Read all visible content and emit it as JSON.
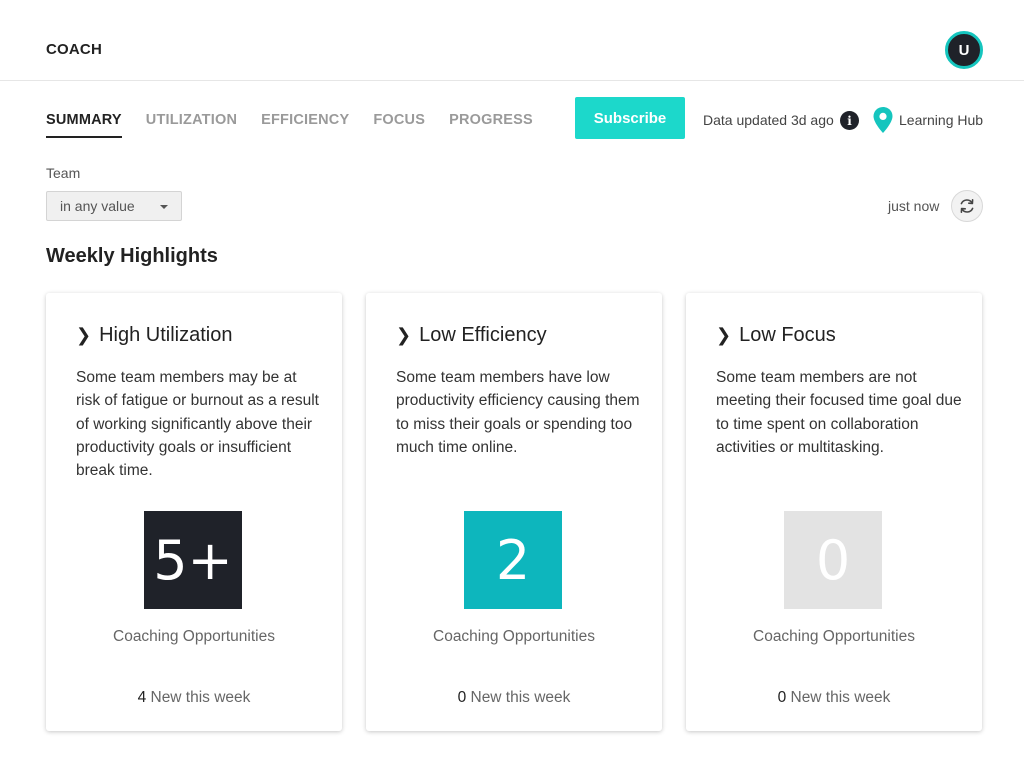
{
  "header": {
    "app_title": "COACH",
    "avatar_initial": "U"
  },
  "nav": {
    "tabs": [
      {
        "label": "SUMMARY",
        "active": true
      },
      {
        "label": "UTILIZATION",
        "active": false
      },
      {
        "label": "EFFICIENCY",
        "active": false
      },
      {
        "label": "FOCUS",
        "active": false
      },
      {
        "label": "PROGRESS",
        "active": false
      }
    ],
    "subscribe_label": "Subscribe",
    "data_updated": "Data updated 3d ago",
    "info_icon_glyph": "i",
    "learning_hub": "Learning Hub"
  },
  "filters": {
    "team_label": "Team",
    "team_value": "in any value",
    "last_refresh": "just now"
  },
  "section": {
    "title": "Weekly Highlights"
  },
  "cards": [
    {
      "title": "High Utilization",
      "description": "Some team members may be at risk of fatigue or burnout as a result of working significantly above their productivity goals or insufficient break time.",
      "count": "5+",
      "count_color": "#1f2229",
      "count_label": "Coaching Opportunities",
      "new_count": "4",
      "new_suffix": " New this week"
    },
    {
      "title": "Low Efficiency",
      "description": "Some team members have low productivity efficiency causing them to miss their goals or spending too much time online.",
      "count": "2",
      "count_color": "#0db6bd",
      "count_label": "Coaching Opportunities",
      "new_count": "0",
      "new_suffix": " New this week"
    },
    {
      "title": "Low Focus",
      "description": "Some team members are not meeting their focused time goal due to time spent on collaboration activities or multitasking.",
      "count": "0",
      "count_color": "#e3e3e3",
      "count_label": "Coaching Opportunities",
      "new_count": "0",
      "new_suffix": " New this week"
    }
  ],
  "colors": {
    "accent": "#1cd8cb",
    "avatar_ring": "#15c5be",
    "pin": "#15c5be",
    "dark": "#1f2229"
  },
  "icons": {
    "info": "info-icon",
    "location": "location-pin-icon",
    "refresh": "refresh-icon",
    "dropdown": "caret-down-icon",
    "card_chevron": "chevron-right-icon"
  }
}
